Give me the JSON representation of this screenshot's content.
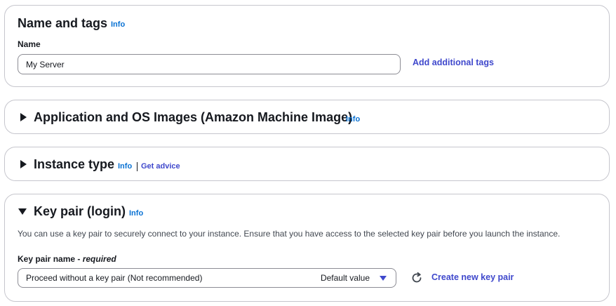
{
  "name_tags": {
    "title": "Name and tags",
    "info": "Info",
    "name_label": "Name",
    "name_value": "My Server",
    "add_tags": "Add additional tags"
  },
  "ami": {
    "title": "Application and OS Images (Amazon Machine Image)",
    "info": "Info"
  },
  "instance_type": {
    "title": "Instance type",
    "info": "Info",
    "get_advice": "Get advice"
  },
  "key_pair": {
    "title": "Key pair (login)",
    "info": "Info",
    "description": "You can use a key pair to securely connect to your instance. Ensure that you have access to the selected key pair before you launch the instance.",
    "field_label": "Key pair name - ",
    "required": "required",
    "selected": "Proceed without a key pair (Not recommended)",
    "default_value": "Default value",
    "create_new": "Create new key pair",
    "refresh_icon": "refresh-icon"
  },
  "colors": {
    "link": "#3f48cc",
    "text": "#16191f",
    "border": "#c6c6cd"
  }
}
